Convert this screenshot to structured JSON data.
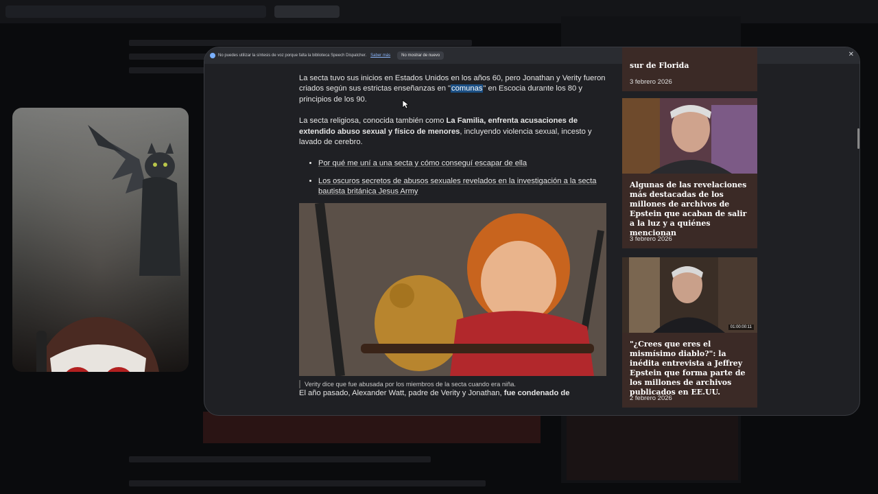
{
  "infobar": {
    "message": "No puedes utilizar la síntesis de voz porque falta la biblioteca Speech Dispatcher.",
    "link": "Saber más",
    "button": "No mostrar de nuevo"
  },
  "article": {
    "p1_a": "La secta tuvo sus inicios en Estados Unidos en los años 60, pero Jonathan y Verity fueron criados según sus estrictas enseñanzas en \"",
    "p1_highlight": "comunas",
    "p1_b": "\" en Escocia durante los 80 y principios de los 90.",
    "p2_a": "La secta religiosa, conocida también como ",
    "p2_bold": "La Familia, enfrenta acusaciones de extendido abuso sexual y físico de menores",
    "p2_b": ", incluyendo violencia sexual, incesto y lavado de cerebro.",
    "bullets": [
      "Por qué me uní a una secta y cómo conseguí escapar de ella",
      "Los oscuros secretos de abusos sexuales revelados en la investigación a la secta bautista británica Jesus Army"
    ],
    "caption": "Verity dice que fue abusada por los miembros de la secta cuando era niña.",
    "p3_a": "El año pasado, Alexander Watt, padre de Verity y Jonathan, ",
    "p3_bold": "fue condenado de"
  },
  "sidebar": {
    "card0": {
      "title_tail": "sur de Florida",
      "date": "3 febrero 2026"
    },
    "card1": {
      "title": "Algunas de las revelaciones más destacadas de los millones de archivos de Epstein que acaban de salir a la luz y a quiénes mencionan",
      "date": "3 febrero 2026"
    },
    "card2": {
      "title": "\"¿Crees que eres el mismísimo diablo?\": la inédita entrevista a Jeffrey Epstein que forma parte de los millones de archivos publicados en EE.UU.",
      "date": "2 febrero 2026",
      "timecode": "01:00:00:11"
    }
  },
  "icons": {
    "info": "info-icon",
    "close": "close-icon",
    "cursor": "mouse-cursor-icon"
  },
  "colors": {
    "highlight": "#1b4f84",
    "card_bg": "#3b2a26",
    "link": "#8ab4f8"
  }
}
